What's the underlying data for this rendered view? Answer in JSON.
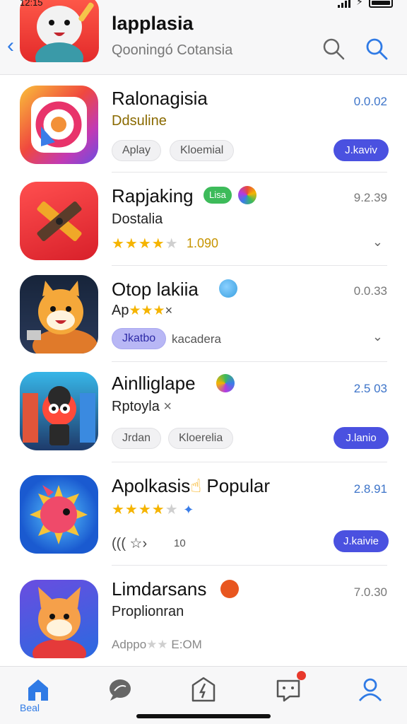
{
  "status_bar": {
    "time": "12:15"
  },
  "header": {
    "back_icon": "chevron-left-icon",
    "title": "lapplasia",
    "subtitle": "Qooningó Cotansia",
    "icons": [
      "search-icon",
      "search-icon"
    ]
  },
  "apps": [
    {
      "name": "Ralonagisia",
      "subtitle": "Ddsuline",
      "version": "0.0.02",
      "chips": [
        "Aplay",
        "Kloemial"
      ],
      "action": "J.kaviv"
    },
    {
      "name": "Rapjaking",
      "badge": "Lisa",
      "subtitle": "Dostalia",
      "version": "9.2.39",
      "rating": "1.090"
    },
    {
      "name": "Otop lakiia",
      "subtitle": "Ap",
      "version": "0.0.33",
      "chips": [
        "Jkatbo"
      ],
      "extra_text": "kacadera"
    },
    {
      "name": "Ainlliglape",
      "subtitle": "Rptoyla",
      "version": "2.5 03",
      "chips": [
        "Jrdan",
        "Kloerelia"
      ],
      "action": "J.lanio"
    },
    {
      "name": "Apolkasis",
      "name_suffix": "Popular",
      "version": "2.8.91",
      "extra_text": "10",
      "action": "J.kaivie"
    },
    {
      "name": "Limdarsans",
      "subtitle": "Proplionran",
      "version": "7.0.30",
      "extra_text": "Adppo",
      "extra_text2": "E:OM"
    }
  ],
  "tabbar": {
    "home_label": "Beal",
    "tabs": [
      "home-icon",
      "chat-icon",
      "compass-icon",
      "inbox-icon",
      "profile-icon"
    ]
  },
  "colors": {
    "accent": "#2f7ae5",
    "button": "#4a51e0",
    "star": "#f5b400"
  }
}
